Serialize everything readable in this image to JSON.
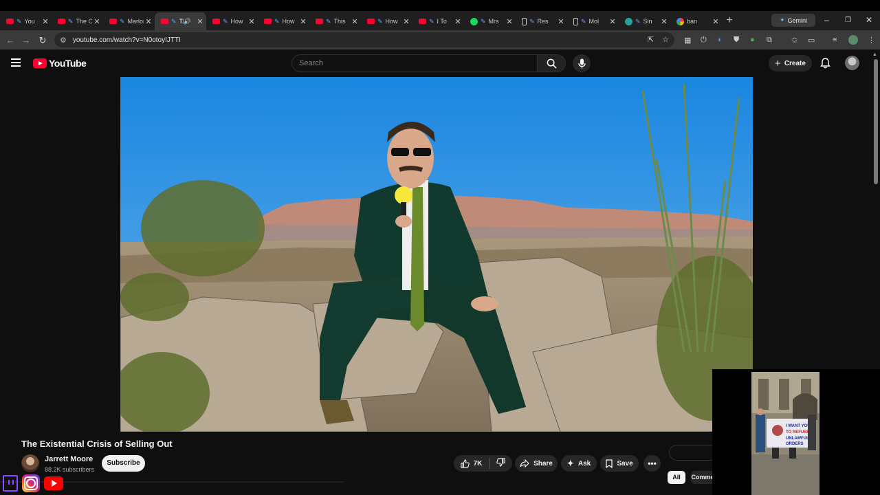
{
  "browser": {
    "tabs": [
      {
        "title": "You",
        "icon": "youtube-favicon",
        "active": false
      },
      {
        "title": "The Ori",
        "icon": "youtube-favicon",
        "active": false
      },
      {
        "title": "Marlon",
        "icon": "youtube-favicon",
        "active": false
      },
      {
        "title": "The",
        "icon": "youtube-favicon",
        "active": true
      },
      {
        "title": "How",
        "icon": "youtube-favicon",
        "active": false
      },
      {
        "title": "How",
        "icon": "youtube-favicon",
        "active": false
      },
      {
        "title": "This",
        "icon": "youtube-favicon",
        "active": false
      },
      {
        "title": "How",
        "icon": "youtube-favicon",
        "active": false
      },
      {
        "title": "I To",
        "icon": "youtube-favicon",
        "active": false
      },
      {
        "title": "Mrs",
        "icon": "spotify-favicon",
        "active": false
      },
      {
        "title": "Res",
        "icon": "device-favicon",
        "active": false
      },
      {
        "title": "Mol",
        "icon": "device-favicon",
        "active": false
      },
      {
        "title": "Sin",
        "icon": "ai-favicon",
        "active": false
      },
      {
        "title": "ban",
        "icon": "google-favicon",
        "active": false
      }
    ],
    "gemini_label": "Gemini",
    "url": "youtube.com/watch?v=N0otoyIJTTI"
  },
  "youtube": {
    "logo_text": "YouTube",
    "search_placeholder": "Search",
    "create_label": "Create"
  },
  "video": {
    "title": "The Existential Crisis of Selling Out",
    "channel": "Jarrett Moore",
    "subscribers": "88.2K subscribers",
    "subscribe_label": "Subscribe",
    "likes": "7K",
    "share_label": "Share",
    "ask_label": "Ask",
    "save_label": "Save"
  },
  "chips": {
    "all": "All",
    "comments": "Comme"
  },
  "miniplayer": {
    "banner_text": "I WANT YOU TO REFUSE UNLAWFUL ORDERS"
  },
  "colors": {
    "accent": "#ff0033",
    "background": "#0f0f0f"
  }
}
